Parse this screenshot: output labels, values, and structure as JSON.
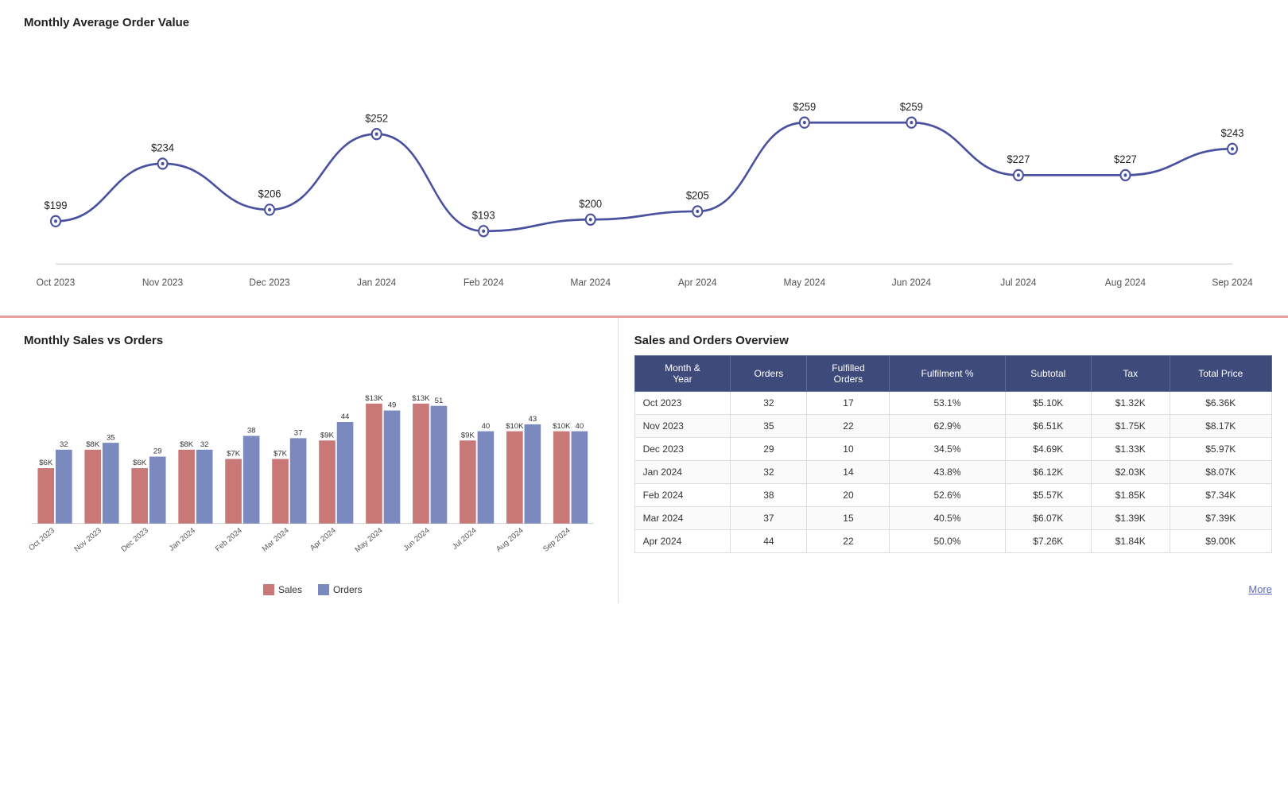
{
  "topChart": {
    "title": "Monthly Average Order Value",
    "points": [
      {
        "month": "Oct 2023",
        "value": 199,
        "label": "$199"
      },
      {
        "month": "Nov 2023",
        "value": 234,
        "label": "$234"
      },
      {
        "month": "Dec 2023",
        "value": 206,
        "label": "$206"
      },
      {
        "month": "Jan 2024",
        "value": 252,
        "label": "$252"
      },
      {
        "month": "Feb 2024",
        "value": 193,
        "label": "$193"
      },
      {
        "month": "Mar 2024",
        "value": 200,
        "label": "$200"
      },
      {
        "month": "Apr 2024",
        "value": 205,
        "label": "$205"
      },
      {
        "month": "May 2024",
        "value": 259,
        "label": "$259"
      },
      {
        "month": "Jun 2024",
        "value": 259,
        "label": "$259"
      },
      {
        "month": "Jul 2024",
        "value": 227,
        "label": "$227"
      },
      {
        "month": "Aug 2024",
        "value": 227,
        "label": "$227"
      },
      {
        "month": "Sep 2024",
        "value": 243,
        "label": "$243"
      }
    ]
  },
  "barChart": {
    "title": "Monthly Sales vs Orders",
    "legend": {
      "sales_label": "Sales",
      "orders_label": "Orders",
      "sales_color": "#c97878",
      "orders_color": "#7a8abf"
    },
    "bars": [
      {
        "month": "Oct 2023",
        "sales": 6,
        "sales_label": "$6K",
        "orders": 32
      },
      {
        "month": "Nov 2023",
        "sales": 8,
        "sales_label": "$8K",
        "orders": 35
      },
      {
        "month": "Dec 2023",
        "sales": 6,
        "sales_label": "$6K",
        "orders": 29
      },
      {
        "month": "Jan 2024",
        "sales": 8,
        "sales_label": "$8K",
        "orders": 32
      },
      {
        "month": "Feb 2024",
        "sales": 7,
        "sales_label": "$7K",
        "orders": 38
      },
      {
        "month": "Mar 2024",
        "sales": 7,
        "sales_label": "$7K",
        "orders": 37
      },
      {
        "month": "Apr 2024",
        "sales": 9,
        "sales_label": "$9K",
        "orders": 44
      },
      {
        "month": "May 2024",
        "sales": 13,
        "sales_label": "$13K",
        "orders": 49
      },
      {
        "month": "Jun 2024",
        "sales": 13,
        "sales_label": "$13K",
        "orders": 51
      },
      {
        "month": "Jul 2024",
        "sales": 9,
        "sales_label": "$9K",
        "orders": 40
      },
      {
        "month": "Aug 2024",
        "sales": 10,
        "sales_label": "$10K",
        "orders": 43
      },
      {
        "month": "Sep 2024",
        "sales": 10,
        "sales_label": "$10K",
        "orders": 40
      }
    ]
  },
  "overviewTable": {
    "title": "Sales and Orders Overview",
    "headers": [
      "Month &\nYear",
      "Orders",
      "Fulfilled\nOrders",
      "Fulfilment %",
      "Subtotal",
      "Tax",
      "Total Price"
    ],
    "rows": [
      {
        "month": "Oct 2023",
        "orders": 32,
        "fulfilled": 17,
        "pct": "53.1%",
        "subtotal": "$5.10K",
        "tax": "$1.32K",
        "total": "$6.36K"
      },
      {
        "month": "Nov 2023",
        "orders": 35,
        "fulfilled": 22,
        "pct": "62.9%",
        "subtotal": "$6.51K",
        "tax": "$1.75K",
        "total": "$8.17K"
      },
      {
        "month": "Dec 2023",
        "orders": 29,
        "fulfilled": 10,
        "pct": "34.5%",
        "subtotal": "$4.69K",
        "tax": "$1.33K",
        "total": "$5.97K"
      },
      {
        "month": "Jan 2024",
        "orders": 32,
        "fulfilled": 14,
        "pct": "43.8%",
        "subtotal": "$6.12K",
        "tax": "$2.03K",
        "total": "$8.07K"
      },
      {
        "month": "Feb 2024",
        "orders": 38,
        "fulfilled": 20,
        "pct": "52.6%",
        "subtotal": "$5.57K",
        "tax": "$1.85K",
        "total": "$7.34K"
      },
      {
        "month": "Mar 2024",
        "orders": 37,
        "fulfilled": 15,
        "pct": "40.5%",
        "subtotal": "$6.07K",
        "tax": "$1.39K",
        "total": "$7.39K"
      },
      {
        "month": "Apr 2024",
        "orders": 44,
        "fulfilled": 22,
        "pct": "50.0%",
        "subtotal": "$7.26K",
        "tax": "$1.84K",
        "total": "$9.00K"
      }
    ]
  },
  "more_link": "More"
}
